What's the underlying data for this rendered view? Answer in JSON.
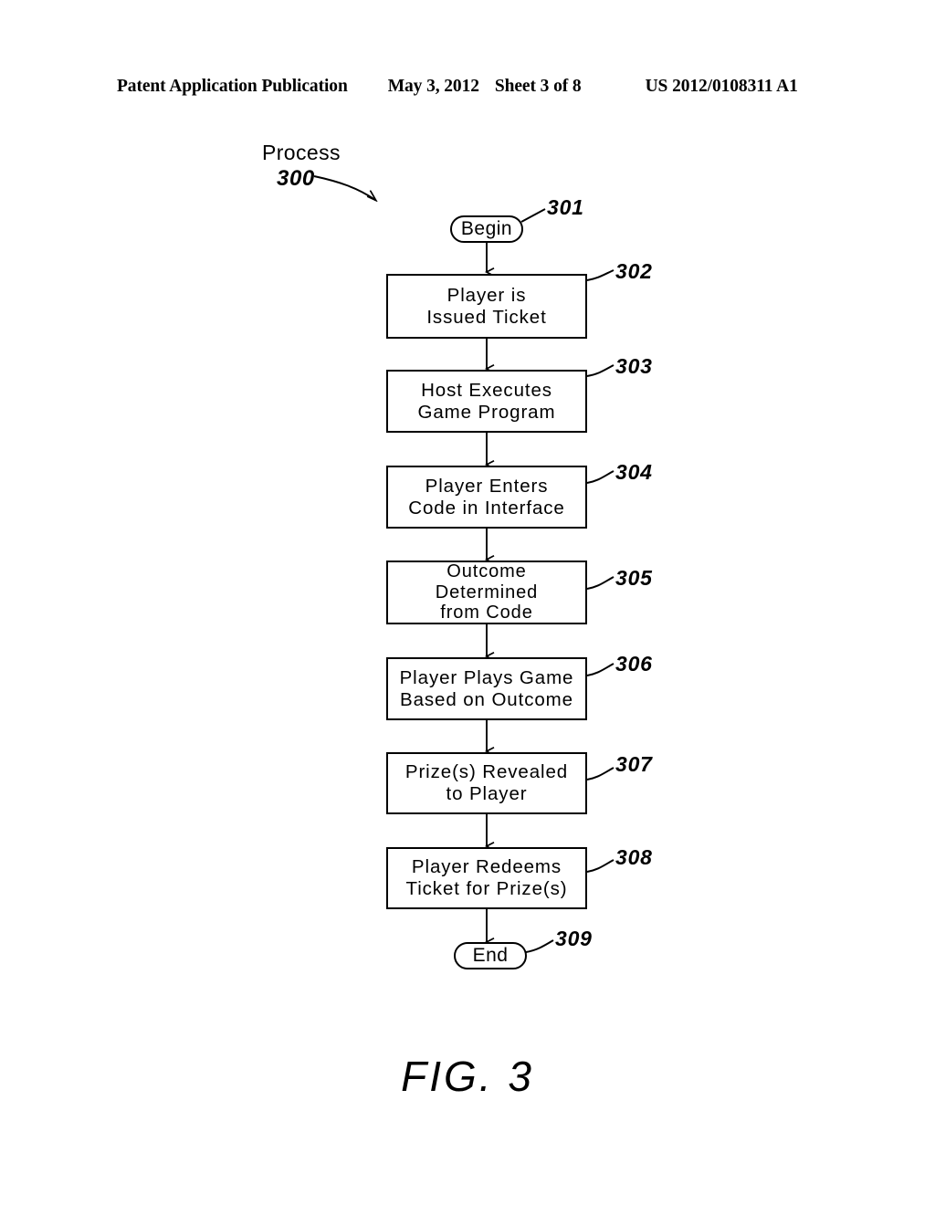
{
  "header": {
    "publication": "Patent Application Publication",
    "date": "May 3, 2012",
    "sheet": "Sheet 3 of 8",
    "patent_number": "US 2012/0108311 A1"
  },
  "figure": {
    "caption": "FIG.  3",
    "process_label": "Process",
    "process_number": "300"
  },
  "flowchart": {
    "type": "flowchart",
    "orientation": "vertical",
    "nodes": [
      {
        "ref": "301",
        "shape": "terminal",
        "text": "Begin"
      },
      {
        "ref": "302",
        "shape": "process",
        "text": "Player is\nIssued Ticket"
      },
      {
        "ref": "303",
        "shape": "process",
        "text": "Host Executes\nGame Program"
      },
      {
        "ref": "304",
        "shape": "process",
        "text": "Player Enters\nCode in Interface"
      },
      {
        "ref": "305",
        "shape": "process",
        "text": "Outcome\nDetermined\nfrom Code"
      },
      {
        "ref": "306",
        "shape": "process",
        "text": "Player Plays Game\nBased on Outcome"
      },
      {
        "ref": "307",
        "shape": "process",
        "text": "Prize(s) Revealed\nto Player"
      },
      {
        "ref": "308",
        "shape": "process",
        "text": "Player Redeems\nTicket for Prize(s)"
      },
      {
        "ref": "309",
        "shape": "terminal",
        "text": "End"
      }
    ],
    "edges": [
      {
        "from": "301",
        "to": "302"
      },
      {
        "from": "302",
        "to": "303"
      },
      {
        "from": "303",
        "to": "304"
      },
      {
        "from": "304",
        "to": "305"
      },
      {
        "from": "305",
        "to": "306"
      },
      {
        "from": "306",
        "to": "307"
      },
      {
        "from": "307",
        "to": "308"
      },
      {
        "from": "308",
        "to": "309"
      }
    ]
  },
  "colors": {
    "ink": "#000000",
    "paper": "#ffffff"
  }
}
